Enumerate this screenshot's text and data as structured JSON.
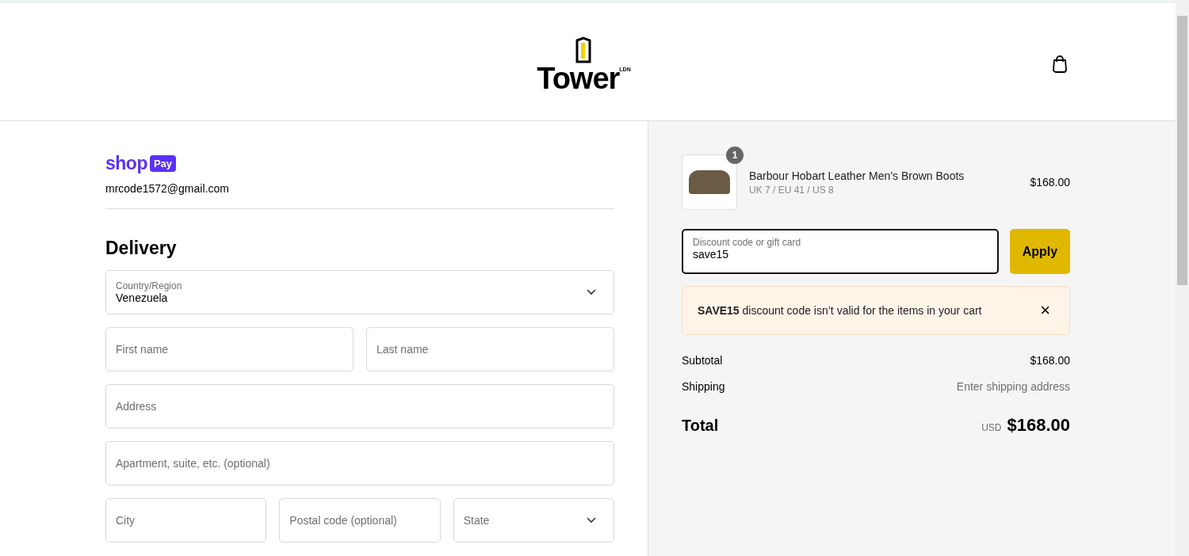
{
  "header": {
    "logo": {
      "name": "Tower",
      "suffix": "LDN"
    }
  },
  "contact": {
    "shop_pay": {
      "wordmark": "shop",
      "badge": "Pay"
    },
    "email": "mrcode1572@gmail.com"
  },
  "delivery": {
    "title": "Delivery",
    "rows": [
      [
        {
          "kind": "select",
          "label": "Country/Region",
          "value": "Venezuela"
        }
      ],
      [
        {
          "kind": "text",
          "placeholder": "First name"
        },
        {
          "kind": "text",
          "placeholder": "Last name"
        }
      ],
      [
        {
          "kind": "text",
          "placeholder": "Address"
        }
      ],
      [
        {
          "kind": "text",
          "placeholder": "Apartment, suite, etc. (optional)"
        }
      ],
      [
        {
          "kind": "text",
          "placeholder": "City"
        },
        {
          "kind": "text",
          "placeholder": "Postal code (optional)"
        },
        {
          "kind": "select",
          "placeholder": "State"
        }
      ]
    ]
  },
  "summary": {
    "items": [
      {
        "name": "Barbour Hobart Leather Men’s Brown Boots",
        "variant": "UK 7 / EU 41 / US 8",
        "price": "$168.00",
        "quantity": "1"
      }
    ],
    "discount": {
      "label": "Discount code or gift card",
      "value": "save15",
      "button": "Apply"
    },
    "alert": {
      "message": "**SAVE15** discount code isn’t valid for the items in your cart",
      "close": "×"
    },
    "lines": [
      {
        "label": "Subtotal",
        "value": "$168.00",
        "muted": false
      },
      {
        "label": "Shipping",
        "value": "Enter shipping address",
        "muted": true
      }
    ],
    "total": {
      "label": "Total",
      "currency": "USD",
      "value": "$168.00"
    }
  }
}
